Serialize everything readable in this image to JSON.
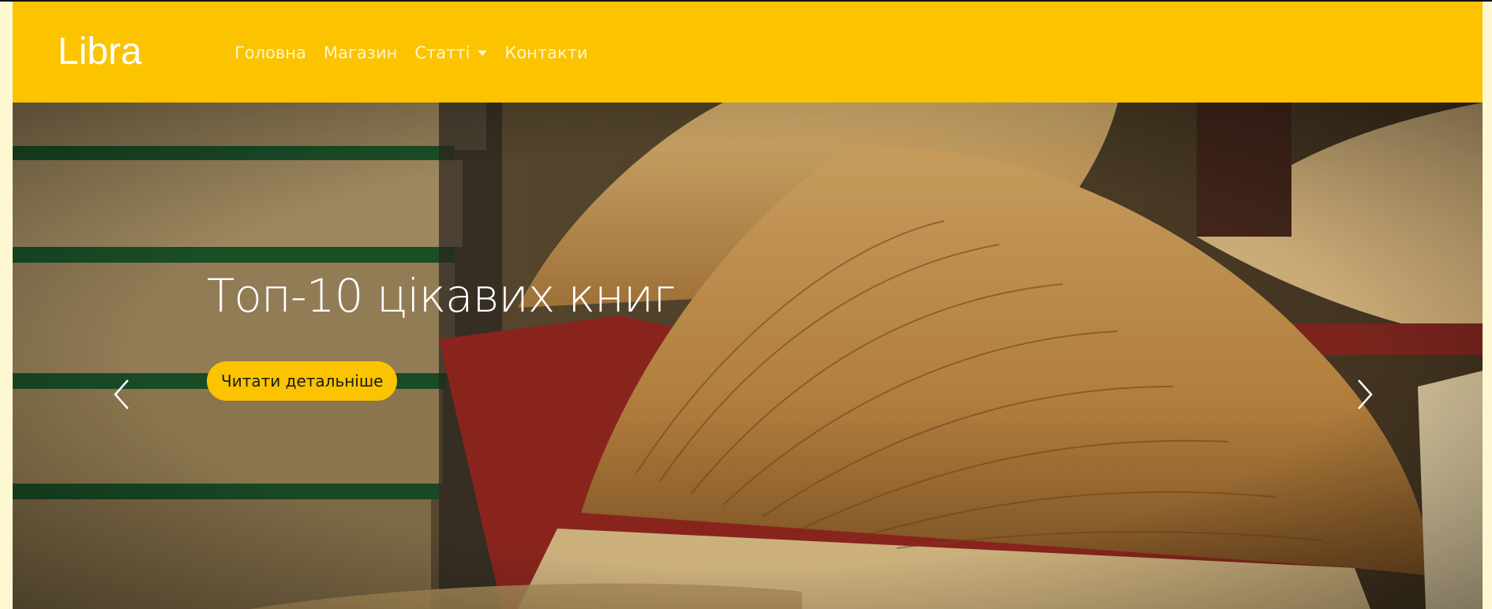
{
  "brand": {
    "name": "Libra"
  },
  "nav": {
    "items": [
      {
        "label": "Головна"
      },
      {
        "label": "Магазин"
      },
      {
        "label": "Статті",
        "has_dropdown": true
      },
      {
        "label": "Контакти"
      }
    ]
  },
  "carousel": {
    "slide_title": "Топ-10 цікавих книг",
    "cta_label": "Читати детальніше",
    "prev_icon": "chevron-left-icon",
    "next_icon": "chevron-right-icon",
    "background_image": "open-books-photo"
  },
  "colors": {
    "accent": "#fbc300",
    "nav_text": "#fff6d0",
    "title_text": "#ffffff"
  }
}
